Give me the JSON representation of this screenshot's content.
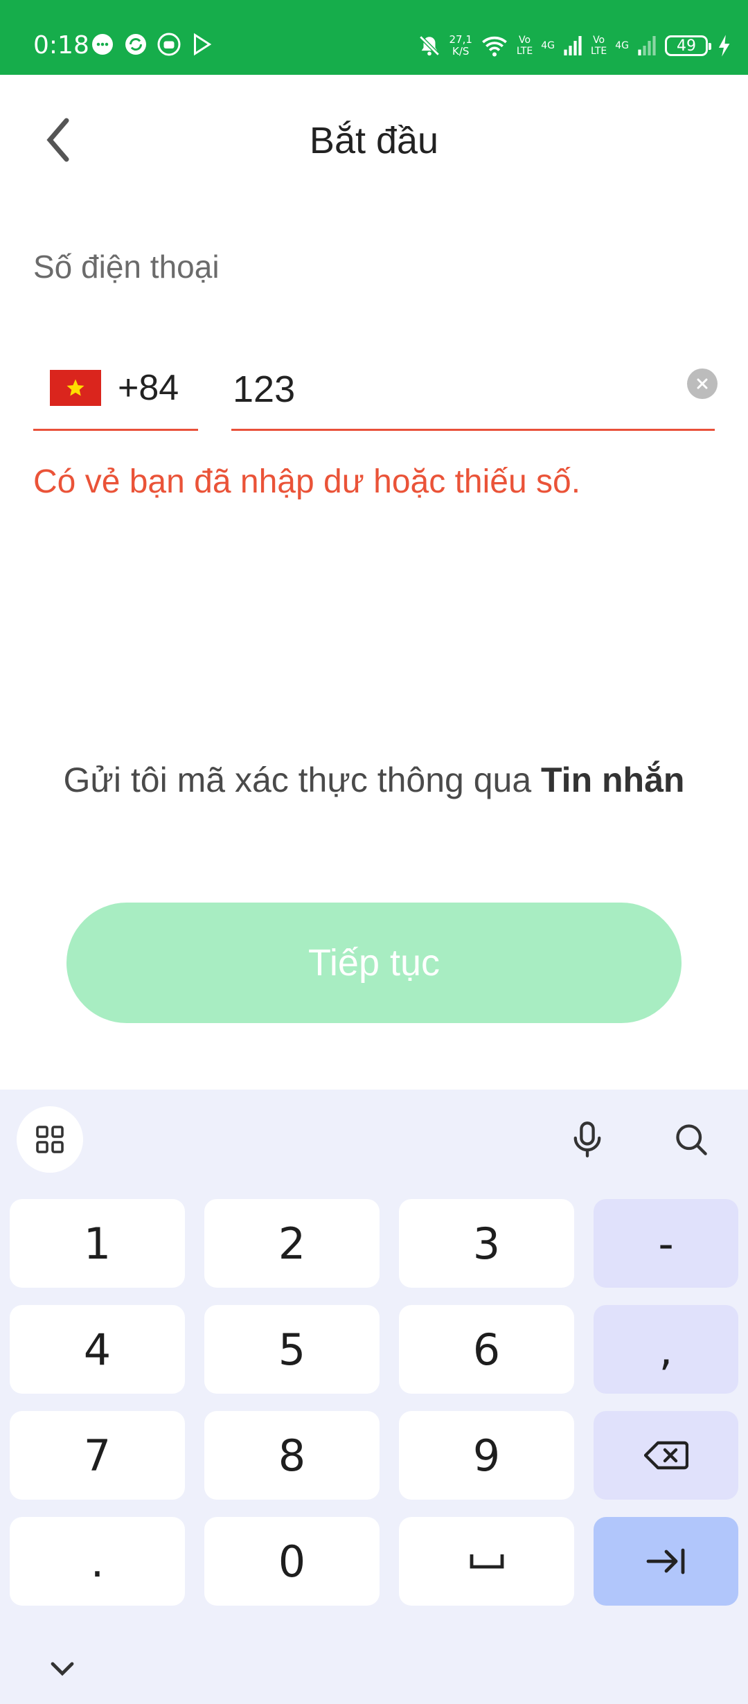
{
  "status_bar": {
    "time": "0:18",
    "net_speed_value": "27,1",
    "net_speed_unit": "K/S",
    "sim1_tag": "Vo",
    "sim1_tech": "LTE",
    "sim1_gen": "4G",
    "sim2_tag": "Vo",
    "sim2_tech": "LTE",
    "sim2_gen": "4G",
    "battery": "49",
    "icons": [
      "message-icon",
      "sync-icon",
      "robot-icon",
      "play-store-icon",
      "bell-off-icon",
      "wifi-icon",
      "signal-icon",
      "signal-icon",
      "battery-icon",
      "charging-icon"
    ]
  },
  "header": {
    "title": "Bắt đầu",
    "back_icon": "chevron-left-icon"
  },
  "form": {
    "phone_label": "Số điện thoại",
    "country_code": "+84",
    "country_flag": "vietnam-flag-icon",
    "phone_value": "123",
    "error_message": "Có vẻ bạn đã nhập dư hoặc thiếu số.",
    "sms_note_prefix": "Gửi tôi mã xác thực thông qua ",
    "sms_note_bold": "Tin nhắn",
    "continue_label": "Tiếp tục"
  },
  "keyboard": {
    "toolbar_icons": [
      "apps-grid-icon",
      "microphone-icon",
      "search-icon"
    ],
    "rows": [
      [
        "1",
        "2",
        "3",
        "-"
      ],
      [
        "4",
        "5",
        "6",
        ","
      ],
      [
        "7",
        "8",
        "9",
        "⌫"
      ],
      [
        ".",
        "0",
        "␣",
        "⇥"
      ]
    ],
    "hide_icon": "chevron-down-icon"
  },
  "colors": {
    "status_bar": "#16ad4b",
    "error": "#ea5338",
    "button_disabled": "#a8edc2",
    "keyboard_bg": "#eef0fb",
    "key_func": "#e0e1fb",
    "key_enter": "#b1c6fb"
  }
}
